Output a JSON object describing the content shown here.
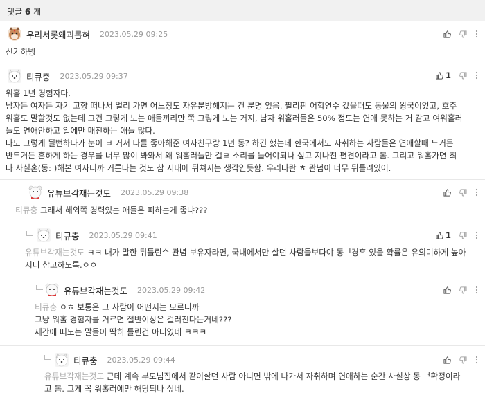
{
  "header": {
    "label": "댓글",
    "count": "6",
    "unit": "개"
  },
  "comments": [
    {
      "nick": "우리서롯왜괴롭혀",
      "date": "2023.05.29 09:25",
      "like_count": "",
      "lines": [
        "신기하넹"
      ]
    },
    {
      "nick": "티큐충",
      "date": "2023.05.29 09:37",
      "like_count": "1",
      "lines": [
        "워홀 1년 경험자다.",
        "남자든 여자든 자기 고향 떠나서 멀리 가면 어느정도 자유분방해지는 건 분명 있음. 필리핀 어학연수 갔을때도 동물의 왕국이었고, 호주",
        "워홀도 말할것도 없는데 그건 그렇게 노는 애들끼리만 쭉 그렇게 노는 거지, 남자 워홀러들은 50% 정도는 연애 못하는 거 같고 여워홀러",
        "들도 연애안하고 일에만 매진하는 애들 많다.",
        "나도 그렇게 될뻔하다가 눈이 ㅂ 거서 나를 좋아해준 여자친구랑 1년 동? 하긴 했는데 한국에서도 자취하는 사람들은 연애할때 ᄃ거든",
        "반ᄃ거든 흔하게 하는 경우를 너무 많이 봐와서 왜 워홀러들만 걸ㄹ 소리를 들어야되나 싶고 지나친 편견이라고 봄. 그리고 워홀가면 최",
        "다 사실혼(동: )해본 여자니까 거른다는 것도 참 시대에 뒤쳐지는 생각인듯함. 우리나란 ㅎ 관념이 너무 뒤틀려있어."
      ]
    },
    {
      "nick": "유튜브각재는것도",
      "date": "2023.05.29 09:38",
      "like_count": "",
      "mention": "티큐충",
      "lines": [
        "그래서 해외쪽 경력있는 애들은 피하는게 좋냐???"
      ]
    },
    {
      "nick": "티큐충",
      "date": "2023.05.29 09:41",
      "like_count": "1",
      "mention": "유튜브각재는것도",
      "lines": [
        "ㅋㅋ 내가 말한 뒤틀린ᄉ 관념 보유자라면, 국내에서만 살던 사람들보다야 동ᅵ경ᄒ 있을 확률은 유의미하게 높아",
        "지니 참고하도록.ㅇㅇ"
      ]
    },
    {
      "nick": "유튜브각재는것도",
      "date": "2023.05.29 09:42",
      "like_count": "",
      "mention": "티큐충",
      "lines": [
        "ㅇㅎ 보통은 그 사람이 어떤지는 모르니까",
        "그냥 워홀 경험자를 거르면 절반이상은 걸러진다는거네???",
        "세간에 떠도는 말들이 딱히 틀린건 아니였네 ㅋㅋㅋ"
      ]
    },
    {
      "nick": "티큐충",
      "date": "2023.05.29 09:44",
      "like_count": "",
      "mention": "유튜브각재는것도",
      "lines": [
        "근데 계속 부모님집에서 같이살던 사람 아니면 밖에 나가서 자취하며 연애하는 순간 사실상 동 ᅥ확정이라",
        "고 봄. 그게 꼭 워홀러에만 해당되나 싶네."
      ]
    }
  ]
}
